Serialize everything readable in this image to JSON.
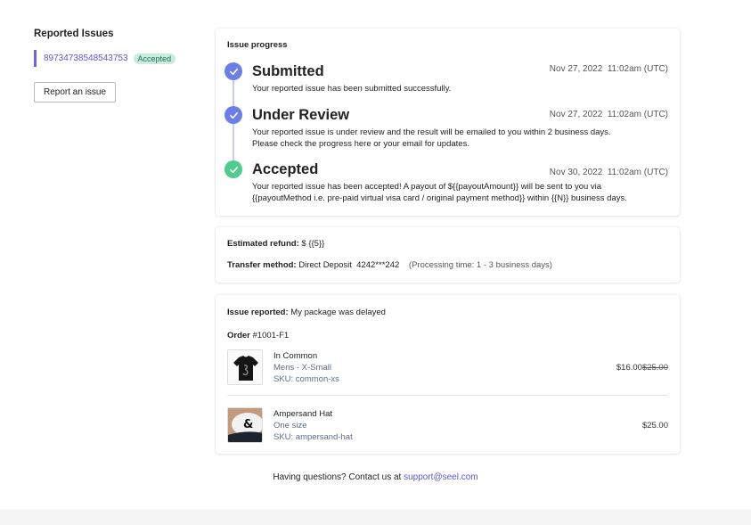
{
  "sidebar": {
    "title": "Reported Issues",
    "issue_id": "89734738548543753",
    "badge": "Accepted",
    "report_button": "Report an issue"
  },
  "progress": {
    "title": "Issue progress",
    "steps": [
      {
        "title": "Submitted",
        "date": "Nov 27, 2022  11:02am (UTC)",
        "desc": [
          "Your reported issue has been submitted successfully."
        ],
        "status": "done"
      },
      {
        "title": "Under Review",
        "date": "Nov 27, 2022  11:02am (UTC)",
        "desc": [
          "Your reported issue is under review and the result will be emailed to you within 2 business days.",
          "Please check the progress here or your email for updates."
        ],
        "status": "done"
      },
      {
        "title": "Accepted",
        "date": "Nov 30, 2022  11:02am (UTC)",
        "desc": [
          "Your reported issue has been accepted! A payout of ${{payoutAmount}} will be sent to you via",
          "{{payoutMethod i.e. pre-paid virtual visa card / original payment method}} within {{N}} business days."
        ],
        "status": "accepted"
      }
    ]
  },
  "refund": {
    "estimated_label": "Estimated refund:",
    "estimated_value": "$ {{5}}",
    "transfer_label": "Transfer method:",
    "transfer_value": "Direct Deposit  4242***242",
    "processing": "(Processing time: 1 - 3 business days)"
  },
  "report": {
    "issue_label": "Issue reported:",
    "issue_value": "My package was delayed",
    "order_label": "Order",
    "order_value": "#1001-F1",
    "items": [
      {
        "name": "In Common",
        "variant": "Mens - X-Small",
        "sku": "SKU: common-xs",
        "price": "$16.00",
        "original_price": "$25.00"
      },
      {
        "name": "Ampersand Hat",
        "variant": "One size",
        "sku": "SKU: ampersand-hat",
        "price": "$25.00"
      }
    ]
  },
  "footer": {
    "text": "Having questions? Contact us at",
    "email": "support@seel.com"
  },
  "colors": {
    "accent": "#5b57d6",
    "step_done": "#6c7fe8",
    "step_accepted": "#4fcb8e",
    "badge_bg": "#c7eedd"
  }
}
